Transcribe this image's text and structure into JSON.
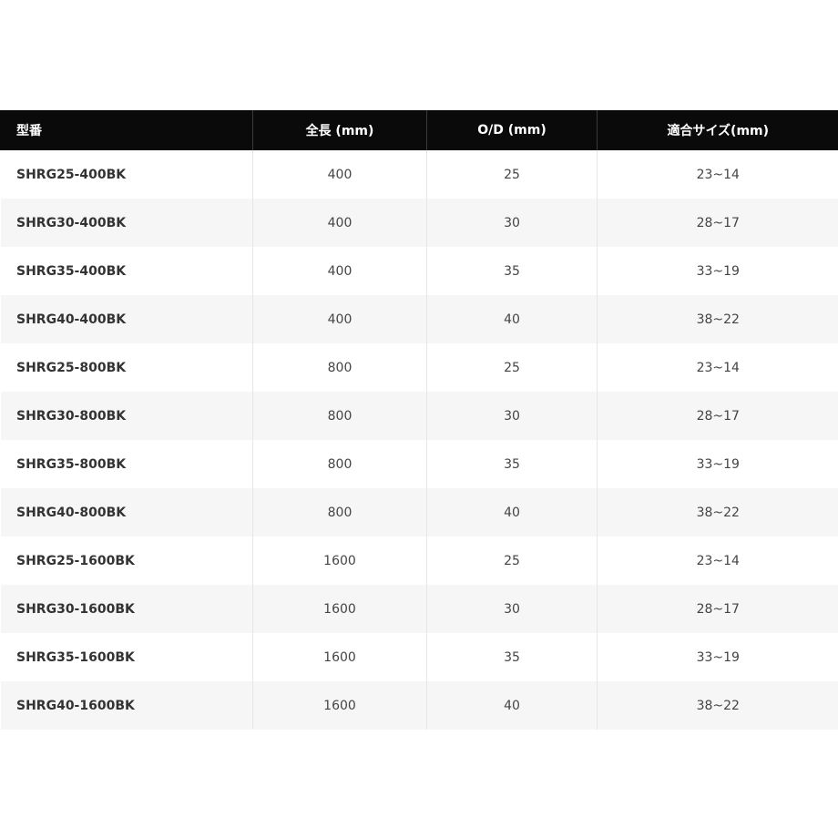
{
  "table": {
    "headers": [
      "型番",
      "全長 (mm)",
      "O/D (mm)",
      "適合サイズ(mm)"
    ],
    "rows": [
      [
        "SHRG25-400BK",
        "400",
        "25",
        "23~14"
      ],
      [
        "SHRG30-400BK",
        "400",
        "30",
        "28~17"
      ],
      [
        "SHRG35-400BK",
        "400",
        "35",
        "33~19"
      ],
      [
        "SHRG40-400BK",
        "400",
        "40",
        "38~22"
      ],
      [
        "SHRG25-800BK",
        "800",
        "25",
        "23~14"
      ],
      [
        "SHRG30-800BK",
        "800",
        "30",
        "28~17"
      ],
      [
        "SHRG35-800BK",
        "800",
        "35",
        "33~19"
      ],
      [
        "SHRG40-800BK",
        "800",
        "40",
        "38~22"
      ],
      [
        "SHRG25-1600BK",
        "1600",
        "25",
        "23~14"
      ],
      [
        "SHRG30-1600BK",
        "1600",
        "30",
        "28~17"
      ],
      [
        "SHRG35-1600BK",
        "1600",
        "35",
        "33~19"
      ],
      [
        "SHRG40-1600BK",
        "1600",
        "40",
        "38~22"
      ]
    ]
  },
  "colors": {
    "header_bg": "#0a0a0a",
    "header_text": "#ffffff",
    "row_alt_bg": "#f6f6f6",
    "body_text": "#333333"
  }
}
